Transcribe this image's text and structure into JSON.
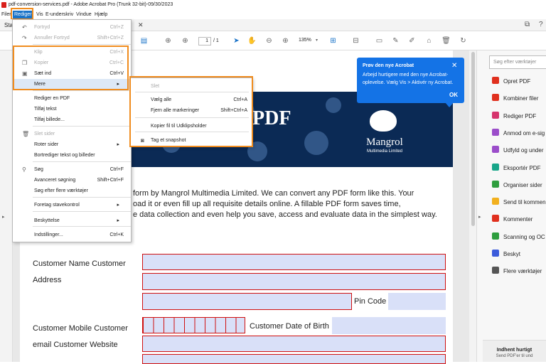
{
  "window": {
    "title": "pdf-conversion-services.pdf - Adobe Acrobat Pro (Trunk 32-bit)-09/30/2023"
  },
  "menubar": {
    "items": [
      "Filer",
      "Rediger",
      "Vis",
      "E-underskriv",
      "Vindue",
      "Hjælp"
    ]
  },
  "tabs": {
    "start": "Sta"
  },
  "toolbar": {
    "page_current": "1",
    "page_total": "/ 1",
    "zoom": "135%"
  },
  "edit_menu": {
    "items": [
      {
        "label": "Fortryd",
        "shortcut": "Ctrl+Z",
        "disabled": true,
        "icon": "undo-icon"
      },
      {
        "label": "Annuller Fortryd",
        "shortcut": "Shift+Ctrl+Z",
        "disabled": true,
        "icon": "redo-icon"
      },
      {
        "label": "Klip",
        "shortcut": "Ctrl+X",
        "disabled": true,
        "icon": ""
      },
      {
        "label": "Kopier",
        "shortcut": "Ctrl+C",
        "disabled": true,
        "icon": "copy-icon"
      },
      {
        "label": "Sæt ind",
        "shortcut": "Ctrl+V",
        "disabled": false,
        "icon": "paste-icon"
      },
      {
        "label": "Mere",
        "shortcut": "",
        "disabled": false,
        "submenu": true
      },
      {
        "label": "Rediger en PDF",
        "shortcut": "",
        "disabled": false
      },
      {
        "label": "Tilføj tekst",
        "shortcut": "",
        "disabled": false
      },
      {
        "label": "Tilføj billede...",
        "shortcut": "",
        "disabled": false
      },
      {
        "label": "Slet sider",
        "shortcut": "",
        "disabled": true,
        "icon": "trash-icon"
      },
      {
        "label": "Roter sider",
        "shortcut": "",
        "disabled": false,
        "submenu": true
      },
      {
        "label": "Bortrediger tekst og billeder",
        "shortcut": "",
        "disabled": false
      },
      {
        "label": "Søg",
        "shortcut": "Ctrl+F",
        "disabled": false,
        "icon": "search-icon"
      },
      {
        "label": "Avanceret søgning",
        "shortcut": "Shift+Ctrl+F",
        "disabled": false
      },
      {
        "label": "Søg efter flere værktøjer",
        "shortcut": "",
        "disabled": false
      },
      {
        "label": "Foretag stavekontrol",
        "shortcut": "",
        "disabled": false,
        "submenu": true
      },
      {
        "label": "Beskyttelse",
        "shortcut": "",
        "disabled": false,
        "submenu": true
      },
      {
        "label": "Indstillinger...",
        "shortcut": "Ctrl+K",
        "disabled": false
      }
    ]
  },
  "more_submenu": {
    "items": [
      {
        "label": "Slet",
        "shortcut": "",
        "disabled": true
      },
      {
        "label": "Vælg alle",
        "shortcut": "Ctrl+A",
        "disabled": false
      },
      {
        "label": "Fjern alle markeringer",
        "shortcut": "Shift+Ctrl+A",
        "disabled": false
      },
      {
        "label": "Kopier fil til Udklipsholder",
        "shortcut": "",
        "disabled": false
      },
      {
        "label": "Tag et snapshot",
        "shortcut": "",
        "disabled": false,
        "icon": "camera-icon"
      }
    ]
  },
  "popup": {
    "title": "Prøv den nye Acrobat",
    "line1": "Arbejd hurtigere med den nye Acrobat-",
    "line2": "oplevelse. Vælg Vis > Aktivér ny Acrobat.",
    "ok": "OK",
    "close": "✕"
  },
  "document": {
    "banner_title": "PDF",
    "logo_name": "Mangrol",
    "logo_sub": "Multimedia Limited",
    "para": [
      "form by Mangrol Multimedia Limited. We can convert any PDF form like this. Your",
      "oad it or even fill up all requisite details online. A fillable PDF form saves time,",
      "e data collection and even help you save, access and evaluate data in the simplest way."
    ],
    "labels": {
      "customer_name": "Customer Name Customer",
      "address": "Address",
      "pin_code": "Pin Code",
      "mobile": "Customer Mobile  Customer",
      "dob": "Customer Date of Birth",
      "email": "email Customer Website"
    }
  },
  "right_panel": {
    "search_placeholder": "Søg efter værktøjer",
    "tools": [
      {
        "label": "Opret PDF",
        "color": "#e0301e"
      },
      {
        "label": "Kombiner filer",
        "color": "#e0301e"
      },
      {
        "label": "Rediger PDF",
        "color": "#d6336c"
      },
      {
        "label": "Anmod om e-sig",
        "color": "#9b4dca"
      },
      {
        "label": "Udfyld og under",
        "color": "#9b4dca"
      },
      {
        "label": "Eksportér PDF",
        "color": "#17a589"
      },
      {
        "label": "Organiser sider",
        "color": "#2e9e3e"
      },
      {
        "label": "Send til kommen",
        "color": "#f2b01e"
      },
      {
        "label": "Kommenter",
        "color": "#e0301e"
      },
      {
        "label": "Scanning og OC",
        "color": "#2e9e3e"
      },
      {
        "label": "Beskyt",
        "color": "#3b5bdb"
      },
      {
        "label": "Flere værktøjer",
        "color": "#555555"
      }
    ],
    "bottom_title": "Indhent hurtigt",
    "bottom_sub": "Send PDF'er til und"
  }
}
